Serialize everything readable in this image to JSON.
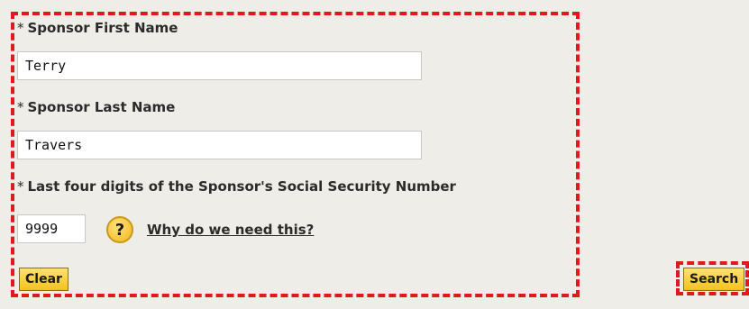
{
  "form": {
    "first_name_label": "Sponsor First Name",
    "first_name_value": "Terry",
    "last_name_label": "Sponsor Last Name",
    "last_name_value": "Travers",
    "ssn_label": "Last four digits of the Sponsor's Social Security Number",
    "ssn_value": "9999",
    "required_marker": "*",
    "help_icon_glyph": "?",
    "help_link": "Why do we need this?",
    "clear_label": "Clear"
  },
  "actions": {
    "search_label": "Search"
  },
  "colors": {
    "background": "#efede7",
    "highlight_border": "#e0191c",
    "button_fill": "#f4c21d"
  },
  "icons": {
    "help": "question-circle-icon"
  }
}
